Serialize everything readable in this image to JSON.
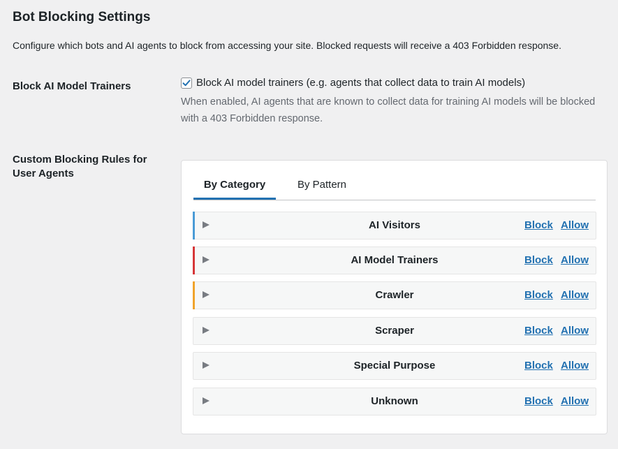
{
  "page": {
    "title": "Bot Blocking Settings",
    "description": "Configure which bots and AI agents to block from accessing your site. Blocked requests will receive a 403 Forbidden response."
  },
  "block_trainers": {
    "label": "Block AI Model Trainers",
    "checkbox_label": "Block AI model trainers (e.g. agents that collect data to train AI models)",
    "checked": true,
    "help": "When enabled, AI agents that are known to collect data for training AI models will be blocked with a 403 Forbidden response."
  },
  "custom_rules": {
    "label": "Custom Blocking Rules for User Agents",
    "tabs": [
      {
        "label": "By Category",
        "active": true
      },
      {
        "label": "By Pattern",
        "active": false
      }
    ],
    "categories": [
      {
        "name": "AI Visitors",
        "accent": "#4a9bd6",
        "block": "Block",
        "allow": "Allow"
      },
      {
        "name": "AI Model Trainers",
        "accent": "#d63638",
        "block": "Block",
        "allow": "Allow"
      },
      {
        "name": "Crawler",
        "accent": "#f0a32b",
        "block": "Block",
        "allow": "Allow"
      },
      {
        "name": "Scraper",
        "accent": "",
        "block": "Block",
        "allow": "Allow"
      },
      {
        "name": "Special Purpose",
        "accent": "",
        "block": "Block",
        "allow": "Allow"
      },
      {
        "name": "Unknown",
        "accent": "",
        "block": "Block",
        "allow": "Allow"
      }
    ]
  },
  "icons": {
    "checkbox": "checkmark-icon",
    "expand": "triangle-right-icon"
  },
  "colors": {
    "link": "#2271b1",
    "tab_active_underline": "#2271b1"
  }
}
